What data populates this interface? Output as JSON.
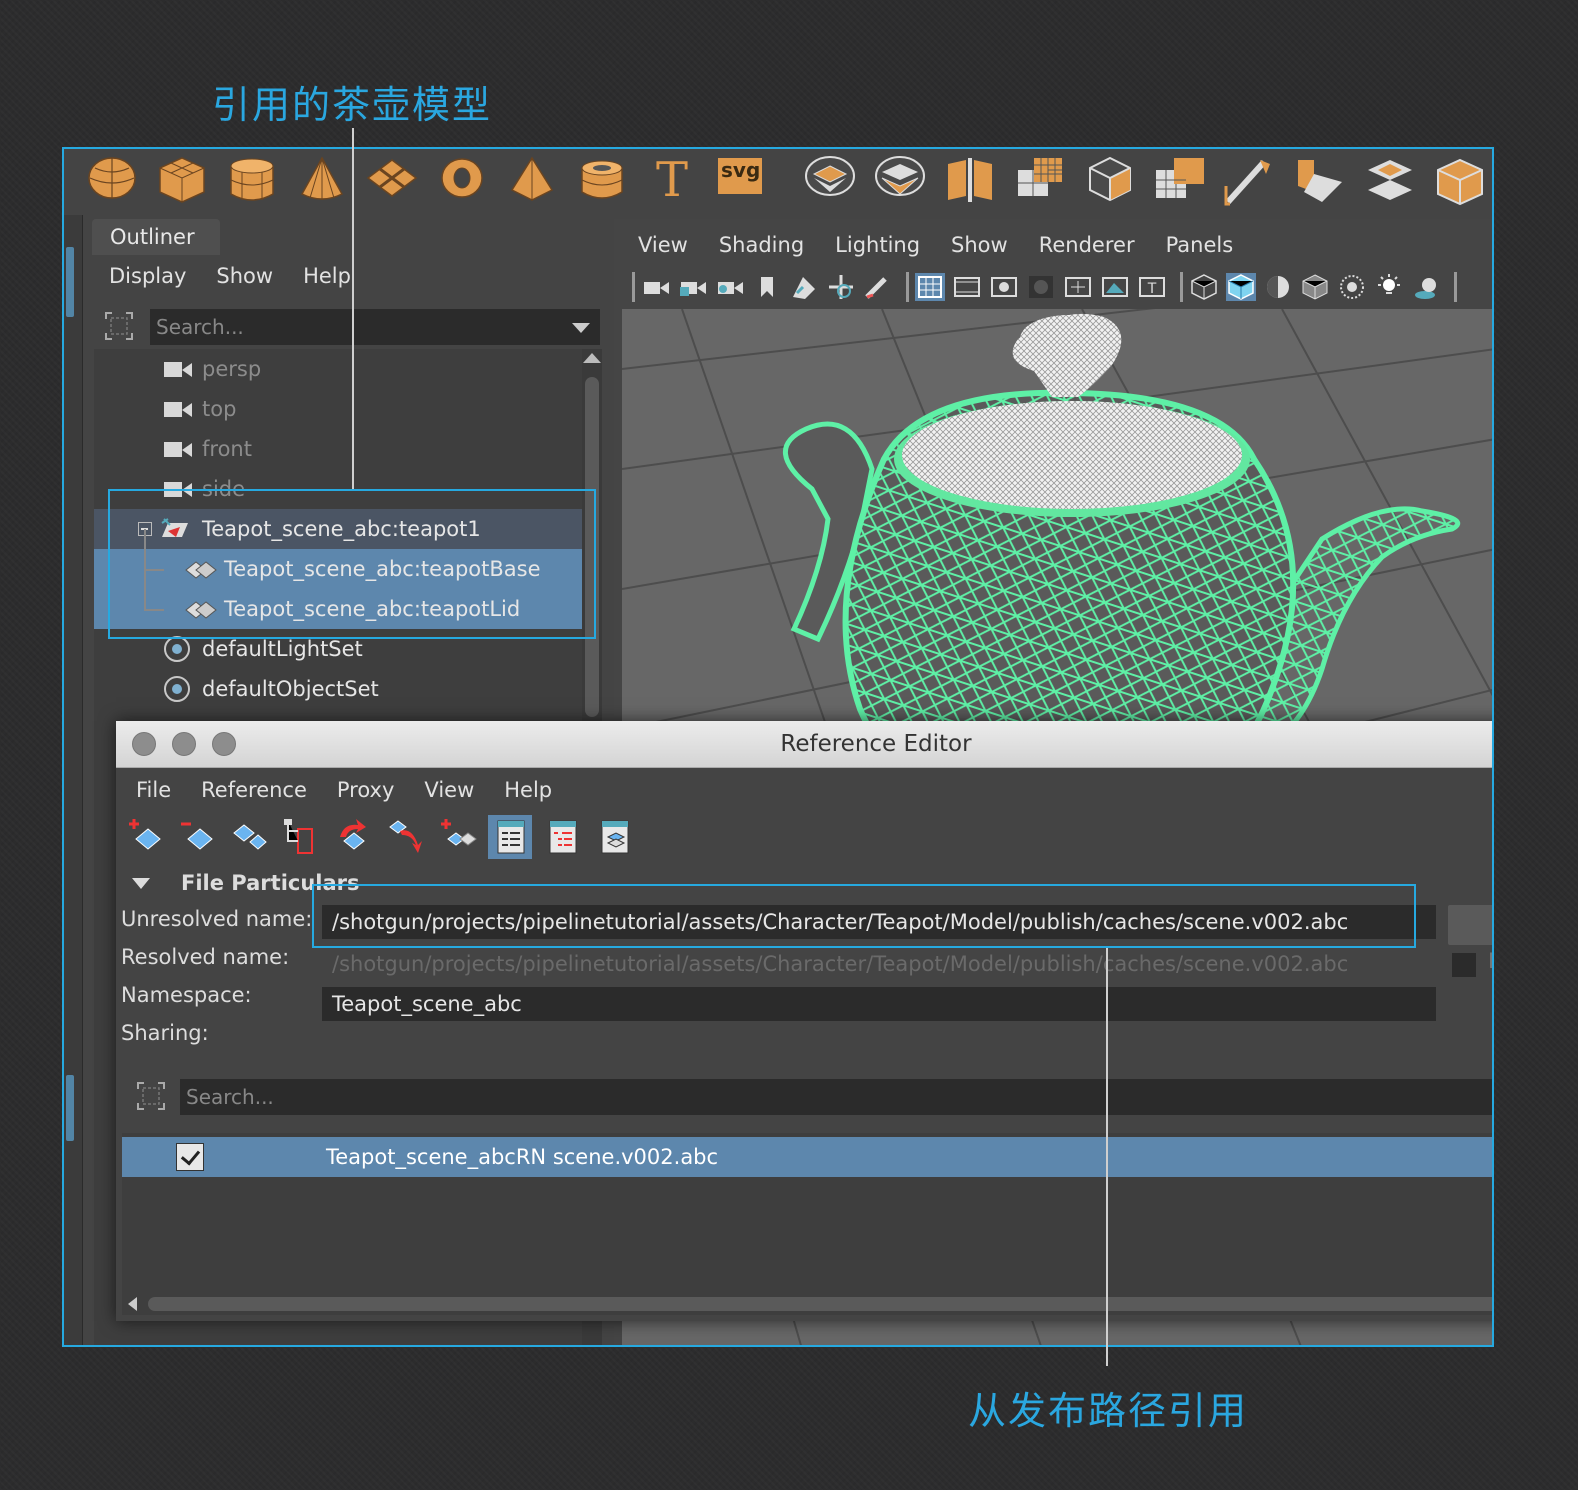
{
  "annotations": {
    "top_label": "引用的茶壶模型",
    "bottom_label": "从发布路径引用"
  },
  "colors": {
    "annotation": "#26a9e0",
    "selection": "#5d87ad",
    "wireframe": "#4fe39a",
    "shelf_icon": "#e09a4c"
  },
  "shelf": {
    "icons": [
      "polygon-sphere-icon",
      "polygon-cube-icon",
      "polygon-cylinder-icon",
      "polygon-cone-icon",
      "polygon-plane-icon",
      "polygon-torus-icon",
      "polygon-pyramid-icon",
      "polygon-pipe-icon",
      "polygon-text-icon",
      "svg-icon",
      "combine-icon",
      "separate-icon",
      "extract-icon",
      "smooth-icon",
      "mirror-icon",
      "boolean-icon",
      "bevel-icon",
      "multicut-icon",
      "extrude-icon",
      "bridge-icon",
      "insert-edge-loop-icon"
    ],
    "svg_label": "svg",
    "text_glyph": "T"
  },
  "outliner": {
    "tab": "Outliner",
    "menu": [
      "Display",
      "Show",
      "Help"
    ],
    "search_placeholder": "Search...",
    "cameras": [
      "persp",
      "top",
      "front",
      "side"
    ],
    "group": "Teapot_scene_abc:teapot1",
    "children": [
      "Teapot_scene_abc:teapotBase",
      "Teapot_scene_abc:teapotLid"
    ],
    "sets": [
      "defaultLightSet",
      "defaultObjectSet"
    ]
  },
  "viewport": {
    "menu": [
      "View",
      "Shading",
      "Lighting",
      "Show",
      "Renderer",
      "Panels"
    ],
    "tool_icons": [
      "camera-icon",
      "camera-lock-icon",
      "camera-attributes-icon",
      "bookmark-icon",
      "image-plane-icon",
      "pan-icon",
      "grease-pencil-icon",
      "grid-icon",
      "film-gate-icon",
      "resolution-gate-icon",
      "gate-mask-icon",
      "field-chart-icon",
      "safe-action-icon",
      "safe-title-icon",
      "wireframe-icon",
      "smooth-shade-icon",
      "default-material-icon",
      "xray-icon",
      "xray-joint-icon",
      "lights-icon",
      "shadows-icon"
    ]
  },
  "reference_editor": {
    "title": "Reference Editor",
    "menu": [
      "File",
      "Reference",
      "Proxy",
      "View",
      "Help"
    ],
    "tool_icons": [
      "create-reference-icon",
      "remove-reference-icon",
      "reload-reference-icon",
      "import-objects-icon",
      "reference-sort-icon",
      "unload-reference-icon",
      "duplicate-reference-icon",
      "list-view-icon",
      "tree-view-icon",
      "namespace-view-icon"
    ],
    "section": "File Particulars",
    "fields": {
      "unresolved_label": "Unresolved name:",
      "unresolved_value": "/shotgun/projects/pipelinetutorial/assets/Character/Teapot/Model/publish/caches/scene.v002.abc",
      "resolved_label": "Resolved name:",
      "resolved_value": "/shotgun/projects/pipelinetutorial/assets/Character/Teapot/Model/publish/caches/scene.v002.abc",
      "namespace_label": "Namespace:",
      "namespace_value": "Teapot_scene_abc",
      "sharing_label": "Sharing:"
    },
    "search_placeholder": "Search...",
    "references": [
      {
        "checked": true,
        "name": "Teapot_scene_abcRN scene.v002.abc"
      }
    ],
    "cut_char": "R"
  }
}
